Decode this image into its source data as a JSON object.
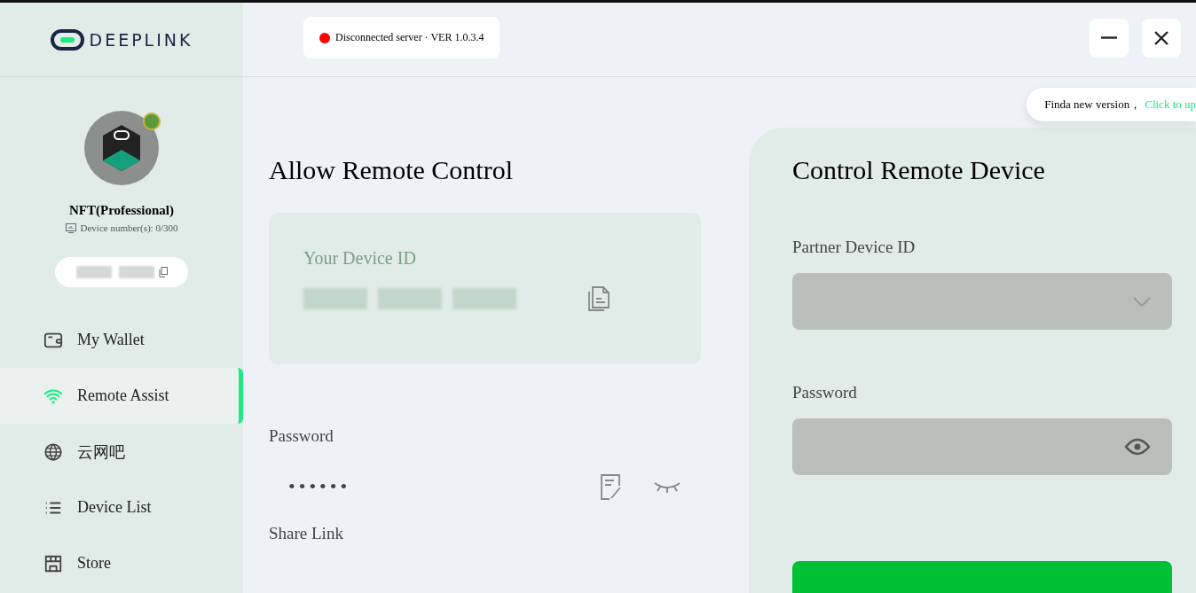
{
  "sidebar": {
    "logo_text": "DEEPLINK",
    "profile": {
      "title": "NFT(Professional)",
      "device_count": "Device number(s): 0/300"
    },
    "items": [
      {
        "label": "My Wallet",
        "kind": "wallet",
        "selected": false
      },
      {
        "label": "Remote Assist",
        "kind": "wifi",
        "selected": true
      },
      {
        "label": "云网吧",
        "kind": "globe",
        "selected": false
      },
      {
        "label": "Device List",
        "kind": "list",
        "selected": false
      },
      {
        "label": "Store",
        "kind": "store",
        "selected": false
      }
    ]
  },
  "status": {
    "connected": false,
    "text": "Disconnected server · VER 1.0.3.4"
  },
  "toast": {
    "text": "Finda new version，",
    "link": "Click to up"
  },
  "allow": {
    "title": "Allow Remote Control",
    "device_id_label": "Your Device ID",
    "password_label": "Password",
    "password_mask": "••••••",
    "share_label": "Share Link"
  },
  "control": {
    "title": "Control Remote Device",
    "partner_label": "Partner Device ID",
    "password_label": "Password"
  }
}
